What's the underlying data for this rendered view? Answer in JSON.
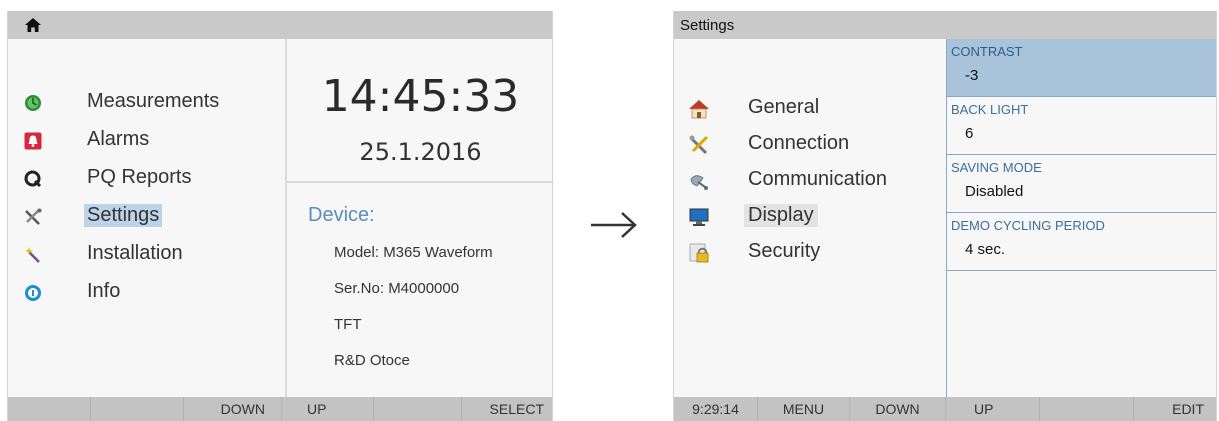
{
  "left_screen": {
    "menu": [
      {
        "label": "Measurements",
        "icon": "measurements-icon",
        "selected": false
      },
      {
        "label": "Alarms",
        "icon": "alarm-bell-icon",
        "selected": false
      },
      {
        "label": "PQ Reports",
        "icon": "pq-reports-icon",
        "selected": false
      },
      {
        "label": "Settings",
        "icon": "settings-tools-icon",
        "selected": true
      },
      {
        "label": "Installation",
        "icon": "installation-wand-icon",
        "selected": false
      },
      {
        "label": "Info",
        "icon": "info-icon",
        "selected": false
      }
    ],
    "clock": {
      "time": "14:45:33",
      "date": "25.1.2016"
    },
    "device": {
      "title": "Device:",
      "lines": [
        "Model:  M365  Waveform",
        "Ser.No: M4000000",
        "TFT",
        "R&D Otoce"
      ]
    },
    "softkeys": [
      "",
      "",
      "DOWN",
      "UP",
      "",
      "SELECT"
    ]
  },
  "arrow": "→",
  "right_screen": {
    "title": "Settings",
    "menu": [
      {
        "label": "General",
        "icon": "house-icon",
        "selected": false
      },
      {
        "label": "Connection",
        "icon": "tools-icon",
        "selected": false
      },
      {
        "label": "Communication",
        "icon": "satellite-icon",
        "selected": false
      },
      {
        "label": "Display",
        "icon": "monitor-icon",
        "selected": true
      },
      {
        "label": "Security",
        "icon": "lock-icon",
        "selected": false
      }
    ],
    "params": [
      {
        "name": "CONTRAST",
        "value": "-3",
        "active": true
      },
      {
        "name": "BACK LIGHT",
        "value": "6",
        "active": false
      },
      {
        "name": "SAVING MODE",
        "value": "Disabled",
        "active": false
      },
      {
        "name": "DEMO CYCLING PERIOD",
        "value": "4 sec.",
        "active": false
      }
    ],
    "softkeys": [
      "9:29:14",
      "MENU",
      "DOWN",
      "UP",
      "",
      "EDIT"
    ]
  },
  "colors": {
    "selection_blue": "#bcd3e8",
    "device_title_blue": "#5b8cc0",
    "param_active": "#a9c4da",
    "param_label": "#3a6e9b"
  }
}
